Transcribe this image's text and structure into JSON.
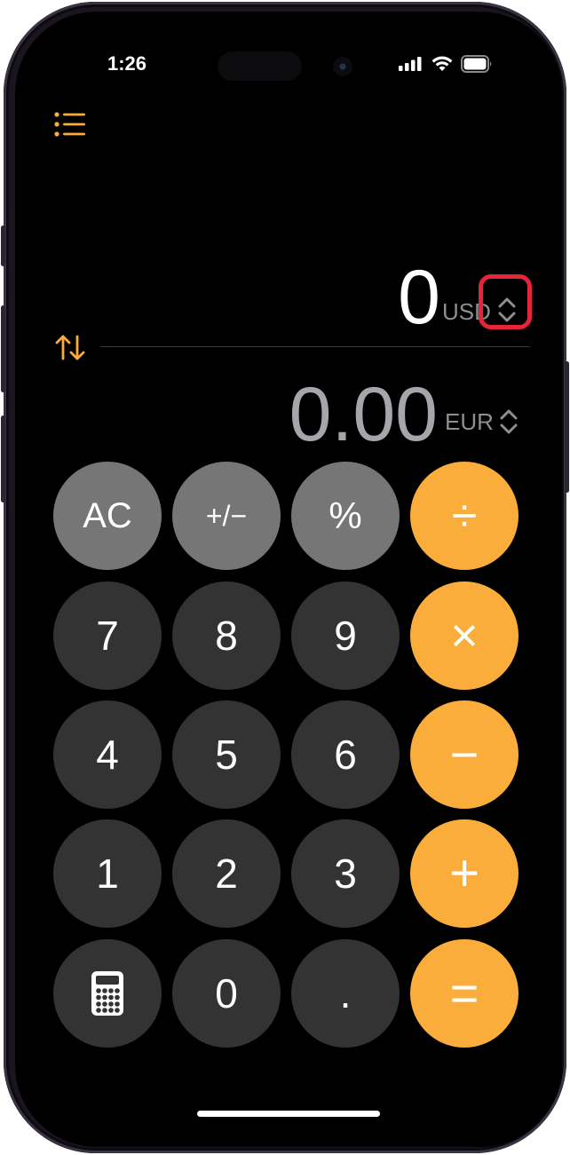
{
  "status_bar": {
    "time": "1:26",
    "signal_icon": "cellular-signal-icon",
    "wifi_icon": "wifi-icon",
    "battery_icon": "battery-icon"
  },
  "toolbar": {
    "menu_icon": "list-icon",
    "swap_icon": "swap-arrows-icon"
  },
  "converter": {
    "top_value": "0",
    "top_unit": "USD",
    "bottom_value": "0.00",
    "bottom_unit": "EUR",
    "unit_picker_icon": "chevron-up-down-icon"
  },
  "keypad": {
    "row1": [
      "AC",
      "+/−",
      "%",
      "÷"
    ],
    "row2": [
      "7",
      "8",
      "9",
      "×"
    ],
    "row3": [
      "4",
      "5",
      "6",
      "−"
    ],
    "row4": [
      "1",
      "2",
      "3",
      "+"
    ],
    "row5": [
      "calculator-icon",
      "0",
      ".",
      "="
    ]
  },
  "colors": {
    "accent": "#fbad3c",
    "function_key": "#767676",
    "number_key": "#333333",
    "highlight_box": "#e8243b",
    "background": "#000000"
  }
}
